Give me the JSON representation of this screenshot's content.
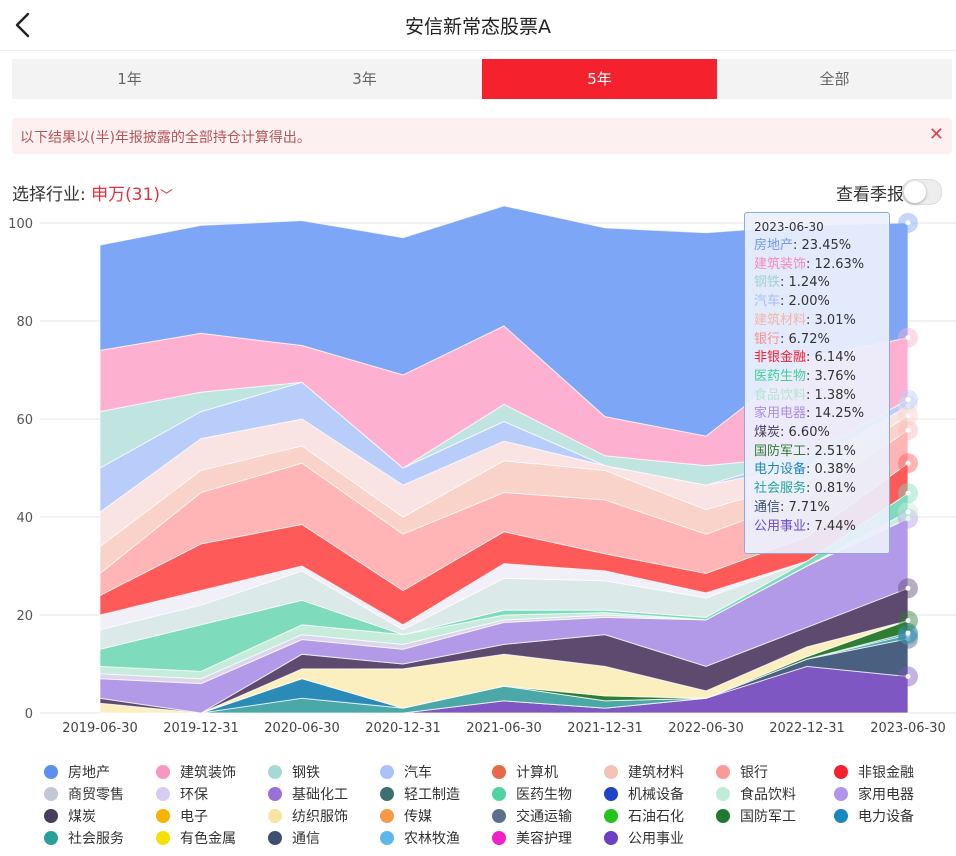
{
  "page": {
    "title": "安信新常态股票A",
    "tabs": [
      "1年",
      "3年",
      "5年",
      "全部"
    ],
    "active_tab": 2,
    "notice": "以下结果以(半)年报披露的全部持仓计算得出。",
    "filter_label": "选择行业:",
    "filter_value": "申万(31)",
    "quarter_label": "查看季报"
  },
  "chart_data": {
    "type": "area",
    "stacked": true,
    "x": [
      "2019-06-30",
      "2019-12-31",
      "2020-06-30",
      "2020-12-31",
      "2021-06-30",
      "2021-12-31",
      "2022-06-30",
      "2022-12-31",
      "2023-06-30"
    ],
    "ylim": [
      0,
      100
    ],
    "yticks": [
      0,
      20,
      40,
      60,
      80,
      100
    ],
    "grid": true,
    "legend_position": "bottom",
    "series": [
      {
        "name": "公用事业",
        "color": "#7e57c2",
        "values": [
          0,
          0,
          0,
          0,
          2.5,
          1,
          3,
          9.5,
          7.44
        ]
      },
      {
        "name": "通信",
        "color": "#4a6080",
        "values": [
          0,
          0,
          0,
          0,
          0,
          0,
          0,
          1.5,
          7.71
        ]
      },
      {
        "name": "社会服务",
        "color": "#4aa8a8",
        "values": [
          0,
          0,
          3,
          1,
          3,
          1.5,
          0,
          0,
          0.81
        ]
      },
      {
        "name": "电力设备",
        "color": "#2a8ab8",
        "values": [
          0,
          0,
          4,
          0,
          0,
          0,
          0,
          0,
          0.38
        ]
      },
      {
        "name": "国防军工",
        "color": "#2e7d32",
        "values": [
          0,
          0,
          0,
          0,
          0,
          1,
          0,
          0.5,
          2.51
        ]
      },
      {
        "name": "纺织服饰",
        "color": "#fbefc0",
        "values": [
          2,
          0,
          2,
          8,
          6.5,
          6,
          1.5,
          2,
          0
        ]
      },
      {
        "name": "煤炭",
        "color": "#5d4a6e",
        "values": [
          1,
          0,
          3,
          1,
          2,
          6.5,
          5,
          4,
          6.6
        ]
      },
      {
        "name": "家用电器",
        "color": "#b39ae8",
        "values": [
          4,
          6,
          3,
          3,
          4.5,
          3.5,
          9.5,
          12.5,
          14.25
        ]
      },
      {
        "name": "环保",
        "color": "#dcd5ee",
        "values": [
          1,
          1,
          1,
          1,
          0.5,
          0.5,
          0,
          0,
          0
        ]
      },
      {
        "name": "食品饮料",
        "color": "#c6ecdc",
        "values": [
          1.5,
          1.5,
          2,
          2,
          1,
          0.5,
          0,
          0,
          1.38
        ]
      },
      {
        "name": "医药生物",
        "color": "#7edcbc",
        "values": [
          3.5,
          9.5,
          5,
          0,
          1,
          0.5,
          0.5,
          1,
          3.76
        ]
      },
      {
        "name": "轻工制造",
        "color": "#dce9e9",
        "values": [
          4,
          4,
          6,
          1,
          6.5,
          6,
          4,
          0,
          0
        ]
      },
      {
        "name": "商贸零售",
        "color": "#f1eff7",
        "values": [
          3,
          3,
          1,
          1,
          3,
          2,
          1,
          0,
          0
        ]
      },
      {
        "name": "非银金融",
        "color": "#ff5a5a",
        "values": [
          4,
          9.5,
          8.5,
          7,
          6.5,
          3.5,
          4,
          5,
          6.14
        ]
      },
      {
        "name": "银行",
        "color": "#ffb5b5",
        "values": [
          4.5,
          10.5,
          12.5,
          11.5,
          8,
          11,
          8,
          8,
          6.72
        ]
      },
      {
        "name": "建筑材料",
        "color": "#f9d3c9",
        "values": [
          5.5,
          4.5,
          3.5,
          3.5,
          6.5,
          6,
          5,
          3.5,
          3.01
        ]
      },
      {
        "name": "汽车",
        "color": "#f9e3e3",
        "values": [
          7,
          6.5,
          5.5,
          6.5,
          4,
          1,
          5,
          3,
          2.0
        ]
      },
      {
        "name": "钢铁",
        "color": "#b8cdfa",
        "values": [
          9,
          5.5,
          7.5,
          3.5,
          4,
          0,
          0,
          2,
          1.24
        ]
      },
      {
        "name": "建筑装饰",
        "color": "#c0e4e0",
        "values": [
          11.5,
          4,
          0,
          0,
          3.5,
          2,
          4,
          0,
          0
        ]
      },
      {
        "name": "房地产",
        "color": "#fdb0d0",
        "values": [
          12.5,
          12,
          7.5,
          19,
          16,
          8,
          6,
          20,
          12.63
        ]
      },
      {
        "name": "房地产_top",
        "color": "#7da6f6",
        "values": [
          21.5,
          22,
          25.5,
          28,
          24.5,
          38.5,
          41.5,
          27,
          23.45
        ]
      }
    ]
  },
  "tooltip": {
    "date": "2023-06-30",
    "rows": [
      {
        "label": "房地产",
        "value": "23.45%",
        "color": "#6f9bf2"
      },
      {
        "label": "建筑装饰",
        "value": "12.63%",
        "color": "#f48bb8"
      },
      {
        "label": "钢铁",
        "value": "1.24%",
        "color": "#9fd4d0"
      },
      {
        "label": "汽车",
        "value": "2.00%",
        "color": "#a4bff6"
      },
      {
        "label": "建筑材料",
        "value": "3.01%",
        "color": "#f1b6a7"
      },
      {
        "label": "银行",
        "value": "6.72%",
        "color": "#f79090"
      },
      {
        "label": "非银金融",
        "value": "6.14%",
        "color": "#f5222d"
      },
      {
        "label": "医药生物",
        "value": "3.76%",
        "color": "#3fcf9a"
      },
      {
        "label": "食品饮料",
        "value": "1.38%",
        "color": "#b3e6d2"
      },
      {
        "label": "家用电器",
        "value": "14.25%",
        "color": "#a98ce6"
      },
      {
        "label": "煤炭",
        "value": "6.60%",
        "color": "#4a3d5c"
      },
      {
        "label": "国防军工",
        "value": "2.51%",
        "color": "#2e7d32"
      },
      {
        "label": "电力设备",
        "value": "0.38%",
        "color": "#1e88b8"
      },
      {
        "label": "社会服务",
        "value": "0.81%",
        "color": "#26a69a"
      },
      {
        "label": "通信",
        "value": "7.71%",
        "color": "#3d4f73"
      },
      {
        "label": "公用事业",
        "value": "7.44%",
        "color": "#6c4bc5"
      }
    ]
  },
  "legend": [
    {
      "label": "房地产",
      "color": "#5b8ff0"
    },
    {
      "label": "建筑装饰",
      "color": "#f597c0"
    },
    {
      "label": "钢铁",
      "color": "#a8d8d4"
    },
    {
      "label": "汽车",
      "color": "#a9c2f7"
    },
    {
      "label": "计算机",
      "color": "#e8694a"
    },
    {
      "label": "建筑材料",
      "color": "#f4c3b5"
    },
    {
      "label": "银行",
      "color": "#f89a9a"
    },
    {
      "label": "非银金融",
      "color": "#f5222d"
    },
    {
      "label": "商贸零售",
      "color": "#c3c7d4"
    },
    {
      "label": "环保",
      "color": "#d8cdf0"
    },
    {
      "label": "基础化工",
      "color": "#9a6fd8"
    },
    {
      "label": "轻工制造",
      "color": "#3d7070"
    },
    {
      "label": "医药生物",
      "color": "#4fd3a0"
    },
    {
      "label": "机械设备",
      "color": "#1f44c8"
    },
    {
      "label": "食品饮料",
      "color": "#bfebd8"
    },
    {
      "label": "家用电器",
      "color": "#b095e8"
    },
    {
      "label": "煤炭",
      "color": "#4a3d5c"
    },
    {
      "label": "电子",
      "color": "#f5b400"
    },
    {
      "label": "纺织服饰",
      "color": "#f8e3a0"
    },
    {
      "label": "传媒",
      "color": "#f79a46"
    },
    {
      "label": "交通运输",
      "color": "#5c6f8f"
    },
    {
      "label": "石油石化",
      "color": "#22c31f"
    },
    {
      "label": "国防军工",
      "color": "#1f7a30"
    },
    {
      "label": "电力设备",
      "color": "#1888c0"
    },
    {
      "label": "社会服务",
      "color": "#2aa198"
    },
    {
      "label": "有色金属",
      "color": "#f5e000"
    },
    {
      "label": "通信",
      "color": "#3d4f73"
    },
    {
      "label": "农林牧渔",
      "color": "#5cb8e8"
    },
    {
      "label": "美容护理",
      "color": "#f01fc8"
    },
    {
      "label": "公用事业",
      "color": "#6c3fc5"
    }
  ]
}
